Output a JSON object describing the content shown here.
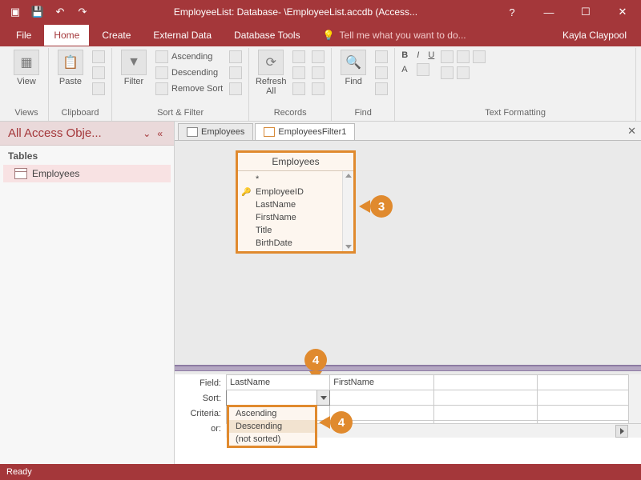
{
  "titlebar": {
    "title": "EmployeeList: Database- \\EmployeeList.accdb (Access..."
  },
  "user": "Kayla Claypool",
  "menus": {
    "file": "File",
    "home": "Home",
    "create": "Create",
    "external": "External Data",
    "dbtools": "Database Tools",
    "tell": "Tell me what you want to do..."
  },
  "ribbon": {
    "views": {
      "view": "View",
      "label": "Views"
    },
    "clipboard": {
      "paste": "Paste",
      "label": "Clipboard"
    },
    "sortfilter": {
      "filter": "Filter",
      "asc": "Ascending",
      "desc": "Descending",
      "remove": "Remove Sort",
      "label": "Sort & Filter"
    },
    "records": {
      "refresh": "Refresh\nAll",
      "label": "Records"
    },
    "find": {
      "find": "Find",
      "label": "Find"
    },
    "textfmt": {
      "label": "Text Formatting"
    }
  },
  "nav": {
    "header": "All Access Obje...",
    "section": "Tables",
    "item1": "Employees"
  },
  "tabs": {
    "t1": "Employees",
    "t2": "EmployeesFilter1"
  },
  "fieldlist": {
    "title": "Employees",
    "star": "*",
    "f1": "EmployeeID",
    "f2": "LastName",
    "f3": "FirstName",
    "f4": "Title",
    "f5": "BirthDate"
  },
  "grid": {
    "labels": {
      "field": "Field:",
      "sort": "Sort:",
      "criteria": "Criteria:",
      "or": "or:"
    },
    "col1": "LastName",
    "col2": "FirstName"
  },
  "sortopts": {
    "asc": "Ascending",
    "desc": "Descending",
    "none": "(not sorted)"
  },
  "callouts": {
    "c3": "3",
    "c4a": "4",
    "c4b": "4"
  },
  "status": "Ready"
}
